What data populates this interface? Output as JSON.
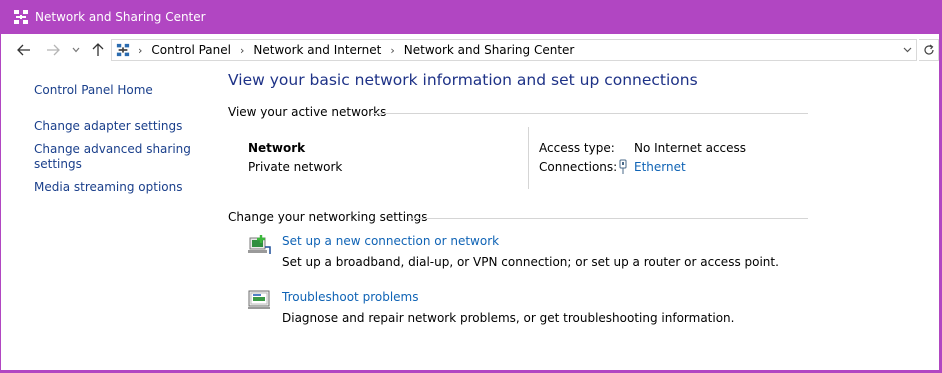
{
  "window": {
    "title": "Network and Sharing Center",
    "accent_color": "#b146c2"
  },
  "navigation": {
    "back_icon": "arrow-left-icon",
    "forward_icon": "arrow-right-icon",
    "recent_icon": "chevron-down-icon",
    "up_icon": "arrow-up-icon",
    "breadcrumbs": [
      "Control Panel",
      "Network and Internet",
      "Network and Sharing Center"
    ],
    "dropdown_icon": "chevron-down-icon",
    "refresh_icon": "refresh-icon"
  },
  "sidebar": {
    "items": [
      {
        "label": "Control Panel Home"
      },
      {
        "label": "Change adapter settings"
      },
      {
        "label": "Change advanced sharing"
      },
      {
        "label": "settings"
      },
      {
        "label": "Media streaming options"
      }
    ]
  },
  "main": {
    "heading": "View your basic network information and set up connections",
    "active_networks_label": "View your active networks",
    "network": {
      "name": "Network",
      "type": "Private network",
      "access_type_label": "Access type:",
      "access_type_value": "No Internet access",
      "connections_label": "Connections:",
      "connections_value": "Ethernet"
    },
    "change_settings_label": "Change your networking settings",
    "tasks": [
      {
        "title": "Set up a new connection or network",
        "description": "Set up a broadband, dial-up, or VPN connection; or set up a router or access point."
      },
      {
        "title": "Troubleshoot problems",
        "description": "Diagnose and repair network problems, or get troubleshooting information."
      }
    ]
  }
}
